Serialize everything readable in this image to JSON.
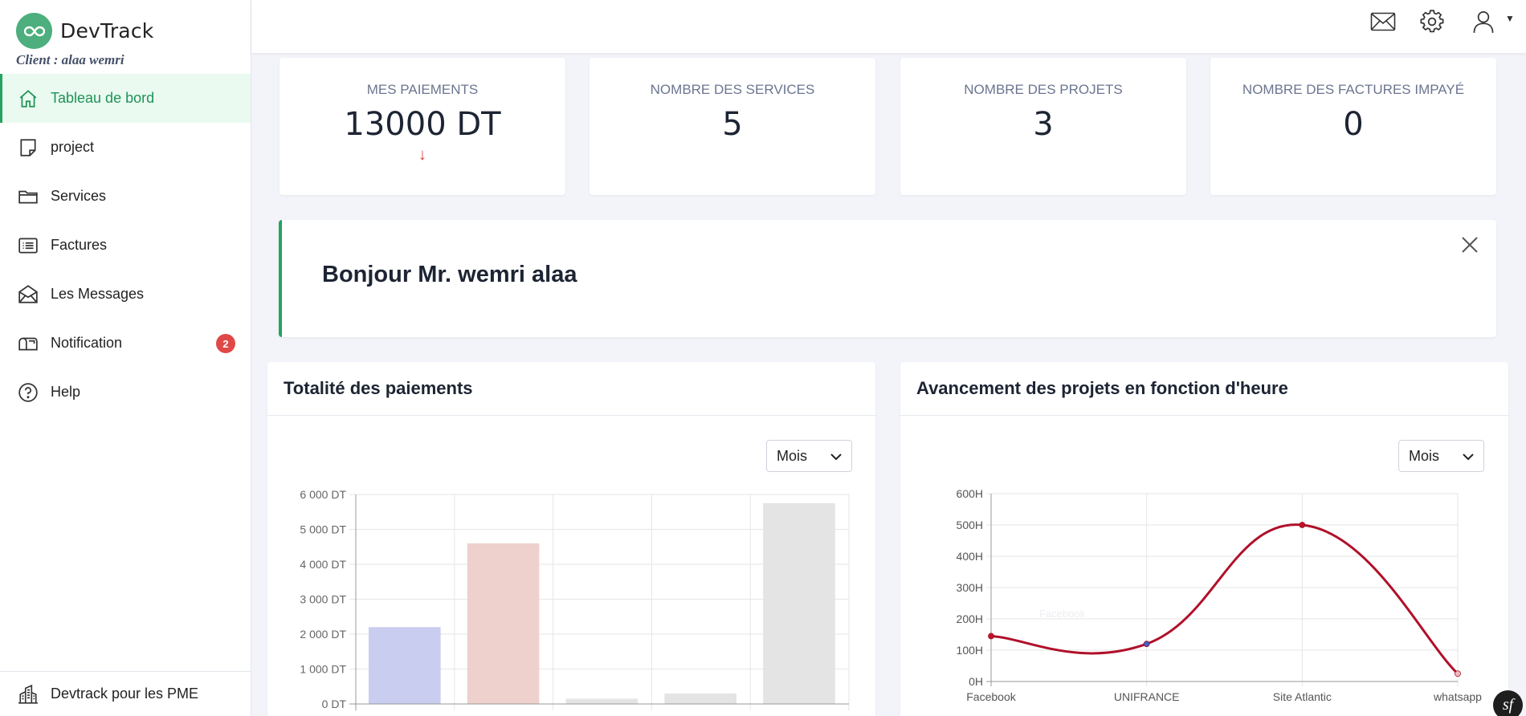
{
  "brand": {
    "name": "DevTrack",
    "client": "Client : alaa wemri"
  },
  "sidebar": {
    "items": [
      {
        "label": "Tableau de bord",
        "icon": "home-icon",
        "active": true
      },
      {
        "label": "project",
        "icon": "note-icon"
      },
      {
        "label": "Services",
        "icon": "folder-icon"
      },
      {
        "label": "Factures",
        "icon": "list-icon"
      },
      {
        "label": "Les Messages",
        "icon": "mail-open-icon"
      },
      {
        "label": "Notification",
        "icon": "mailbox-icon",
        "badge": "2"
      },
      {
        "label": "Help",
        "icon": "help-icon"
      }
    ],
    "footer": {
      "label": "Devtrack pour les PME",
      "icon": "building-icon"
    }
  },
  "header": {
    "icons": [
      "envelope-icon",
      "gear-icon",
      "user-icon"
    ]
  },
  "stats": [
    {
      "label": "MES PAIEMENTS",
      "value": "13000 DT",
      "arrow": "↓"
    },
    {
      "label": "NOMBRE DES SERVICES",
      "value": "5"
    },
    {
      "label": "NOMBRE DES PROJETS",
      "value": "3"
    },
    {
      "label": "NOMBRE DES FACTURES IMPAYÉ",
      "value": "0"
    }
  ],
  "greeting": {
    "text": "Bonjour Mr. wemri alaa"
  },
  "payments_panel": {
    "title": "Totalité des paiements",
    "select": "Mois"
  },
  "progress_panel": {
    "title": "Avancement des projets en fonction d'heure",
    "select": "Mois"
  },
  "colors": {
    "accent": "#27a261",
    "badge": "#e04848",
    "line": "#b0102a"
  },
  "chart_data": [
    {
      "type": "bar",
      "title": "Totalité des paiements",
      "ylim": [
        0,
        6000
      ],
      "yticks": [
        "0 DT",
        "1 000 DT",
        "2 000 DT",
        "3 000 DT",
        "4 000 DT",
        "5 000 DT",
        "6 000 DT"
      ],
      "values": [
        2200,
        4600,
        150,
        300,
        5750
      ],
      "colors": [
        "#c9cdef",
        "#eed1cc",
        "#e4e4e4",
        "#e4e4e4",
        "#e4e4e4"
      ],
      "grid": true
    },
    {
      "type": "line",
      "title": "Avancement des projets en fonction d'heure",
      "categories": [
        "Facebook",
        "UNIFRANCE",
        "Site Atlantic",
        "whatsapp"
      ],
      "values": [
        145,
        120,
        500,
        25
      ],
      "point_colors": [
        "#c0142e",
        "#4060d0",
        "#c0142e",
        "#f0b8c0"
      ],
      "ylim": [
        0,
        600
      ],
      "yticks": [
        "0H",
        "100H",
        "200H",
        "300H",
        "400H",
        "500H",
        "600H"
      ],
      "legend_ghost": "Facebook",
      "grid": true
    }
  ]
}
